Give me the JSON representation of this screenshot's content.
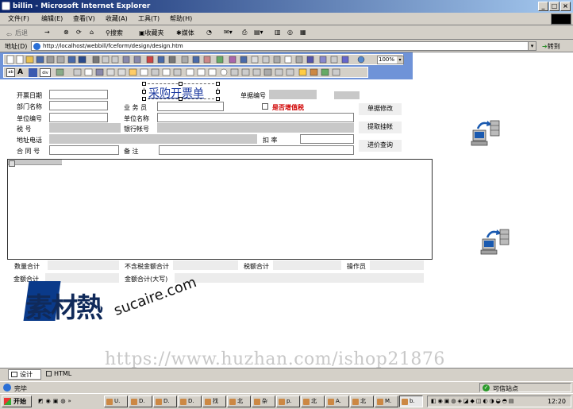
{
  "window": {
    "title": "billin - Microsoft Internet Explorer",
    "min": "_",
    "max": "□",
    "close": "×"
  },
  "menu": [
    "文件(F)",
    "编辑(E)",
    "查看(V)",
    "收藏(A)",
    "工具(T)",
    "帮助(H)"
  ],
  "toolbar": {
    "back": "后退",
    "search": "搜索",
    "favorites": "收藏夹",
    "media": "媒体"
  },
  "address": {
    "label": "地址(D)",
    "url": "http://localhost/webbill/fceform/design/design.htm",
    "go": "转到"
  },
  "editor": {
    "zoom": "100%",
    "text_a": "A",
    "div": "div",
    "ab": "ab"
  },
  "form": {
    "title": "采购开票单",
    "labels": {
      "invoice_date": "开票日期",
      "dept": "部门名称",
      "unit_code": "单位编号",
      "tax_no": "税      号",
      "address_phone": "地址电话",
      "contract_no": "合 同 号",
      "salesperson": "业 务 员",
      "unit_name": "单位名称",
      "bank_account": "银行帐号",
      "remark": "备    注",
      "doc_no": "单据编号",
      "vat": "是否增值税",
      "discount": "扣      率"
    },
    "buttons": {
      "modify": "单据修改",
      "withdraw": "提取挂帐",
      "price_query": "进价查询"
    },
    "totals": {
      "qty": "数量合计",
      "amount_excl_tax": "不含税金额合计",
      "tax": "税额合计",
      "operator": "操作员",
      "amount": "金额合计",
      "amount_upper": "金额合计(大写)"
    }
  },
  "watermark": {
    "brand": "素材熱",
    "brand_url": "sucaire.com",
    "shop": "https://www.huzhan.com/ishop21876"
  },
  "tabs": {
    "design": "设计",
    "html": "HTML"
  },
  "status": {
    "done": "完毕",
    "zone": "可信站点"
  },
  "taskbar": {
    "start": "开始",
    "items": [
      "U.",
      "D.",
      "D.",
      "D.",
      "找",
      "北",
      "杂",
      "p.",
      "北",
      "A.",
      "北",
      "M.",
      "b."
    ],
    "clock": "12:20"
  }
}
